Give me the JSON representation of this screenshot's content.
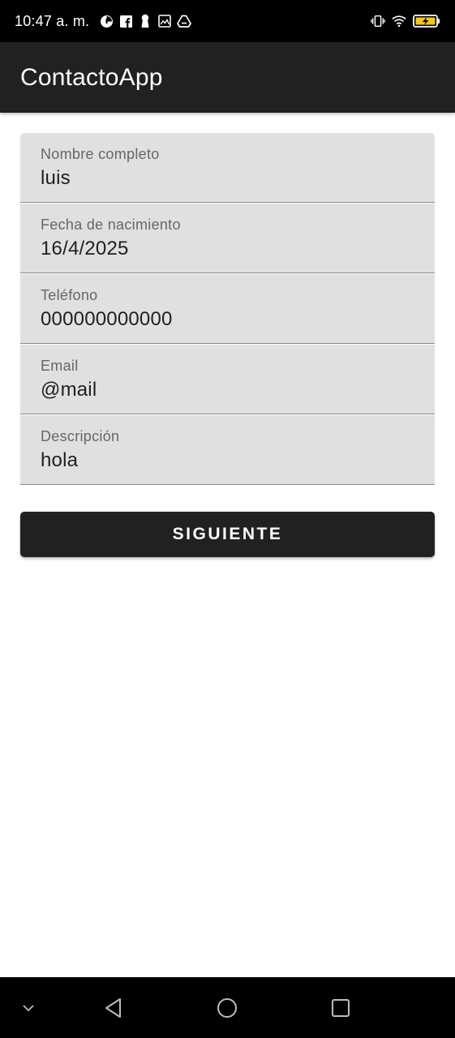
{
  "status_bar": {
    "time": "10:47 a. m.",
    "left_icons": [
      "timer-icon",
      "facebook-icon",
      "keyhole-icon",
      "gallery-icon",
      "drive-icon"
    ],
    "right_icons": [
      "vibrate-icon",
      "wifi-icon",
      "battery-charging-icon"
    ]
  },
  "app_bar": {
    "title": "ContactoApp"
  },
  "form": {
    "fields": [
      {
        "label": "Nombre completo",
        "value": "luis"
      },
      {
        "label": "Fecha de nacimiento",
        "value": "16/4/2025"
      },
      {
        "label": "Teléfono",
        "value": "000000000000"
      },
      {
        "label": "Email",
        "value": "@mail"
      },
      {
        "label": "Descripción",
        "value": "hola"
      }
    ],
    "next_button": "SIGUIENTE"
  },
  "nav_bar": {
    "items": [
      "chevron-down-icon",
      "back-icon",
      "home-icon",
      "recents-icon"
    ]
  },
  "colors": {
    "app_bar": "#212121",
    "field_bg": "#e0e0e0",
    "button_bg": "#212121",
    "battery_accent": "#f5c518"
  }
}
